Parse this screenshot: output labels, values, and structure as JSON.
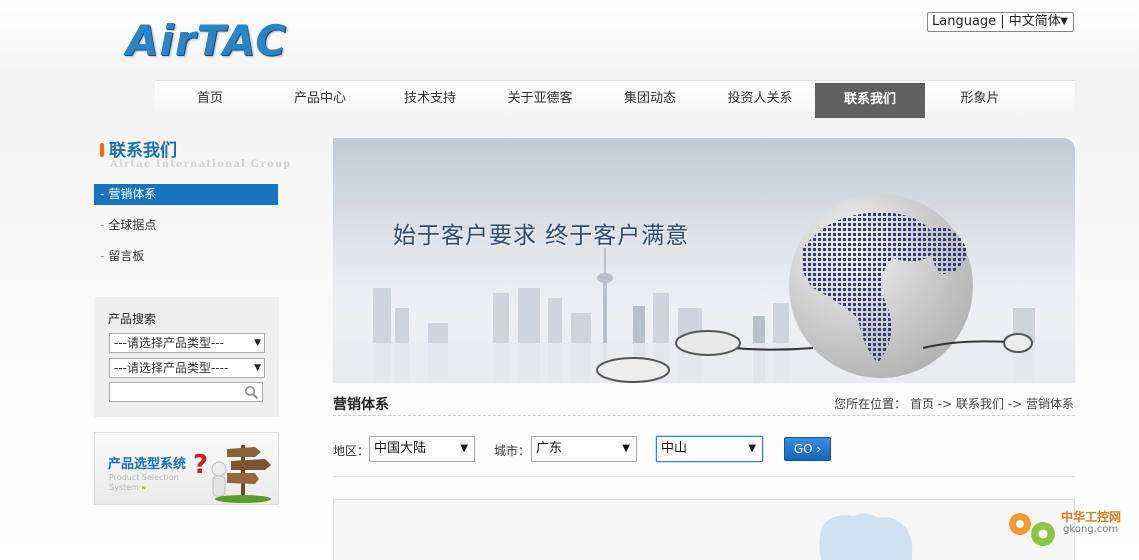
{
  "logo": {
    "text": "AirTAC"
  },
  "language": {
    "label": "Language | 中文简体"
  },
  "nav": {
    "items": [
      {
        "label": "首页"
      },
      {
        "label": "产品中心"
      },
      {
        "label": "技术支持"
      },
      {
        "label": "关于亚德客"
      },
      {
        "label": "集团动态"
      },
      {
        "label": "投资人关系"
      },
      {
        "label": "联系我们",
        "active": true
      },
      {
        "label": "形象片"
      }
    ]
  },
  "sidebar": {
    "title": "联系我们",
    "subtitle": "Airtac International Group",
    "items": [
      {
        "label": "营销体系",
        "active": true
      },
      {
        "label": "全球据点"
      },
      {
        "label": "留言板"
      }
    ]
  },
  "product_search": {
    "title": "产品搜索",
    "select1": "---请选择产品类型---",
    "select2": "---请选择产品类型----",
    "input_value": ""
  },
  "promo": {
    "title": "产品选型系统",
    "subtitle": "Product Selection System",
    "arrow": "»"
  },
  "banner": {
    "slogan": "始于客户要求  终于客户满意"
  },
  "page": {
    "heading": "营销体系",
    "breadcrumb": "您所在位置： 首页 -> 联系我们 -> 营销体系"
  },
  "filters": {
    "region_label": "地区：",
    "region_value": "中国大陆",
    "city_label": "城市：",
    "city_value": "广东",
    "district_value": "中山",
    "go_label": "GO ›"
  },
  "watermark": {
    "title": "中华工控网",
    "sub": "gkong.com"
  },
  "colors": {
    "brand_blue": "#1874c0",
    "accent_orange": "#ff6a00",
    "nav_active": "#606060"
  }
}
